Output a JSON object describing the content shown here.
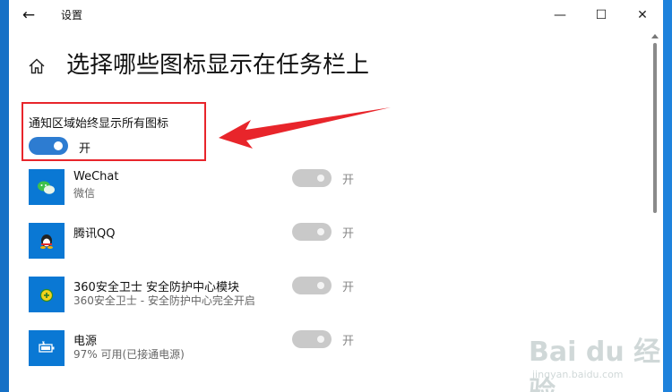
{
  "window": {
    "title": "设置",
    "back_icon": "back-arrow-icon",
    "controls": [
      "minimize-icon",
      "maximize-icon",
      "close-icon"
    ]
  },
  "page": {
    "title": "选择哪些图标显示在任务栏上",
    "home_icon": "home-icon"
  },
  "master_setting": {
    "label": "通知区域始终显示所有图标",
    "state_label": "开",
    "on": true
  },
  "apps": [
    {
      "name": "WeChat",
      "subtitle": "微信",
      "state_label": "开",
      "icon": "wechat-icon"
    },
    {
      "name": "腾讯QQ",
      "subtitle": "",
      "state_label": "开",
      "icon": "qq-icon"
    },
    {
      "name": "360安全卫士 安全防护中心模块",
      "subtitle": "360安全卫士 - 安全防护中心完全开启",
      "state_label": "开",
      "icon": "360-shield-icon"
    },
    {
      "name": "电源",
      "subtitle": "97% 可用(已接通电源)",
      "state_label": "开",
      "icon": "battery-icon"
    }
  ],
  "watermark": {
    "logo": "Bai du 经验",
    "url": "jingyan.baidu.com"
  },
  "colors": {
    "accent": "#2d7cd1",
    "app_tile": "#0a78d4",
    "annotation_red": "#e8252b",
    "desktop": "#1c7ad6"
  }
}
